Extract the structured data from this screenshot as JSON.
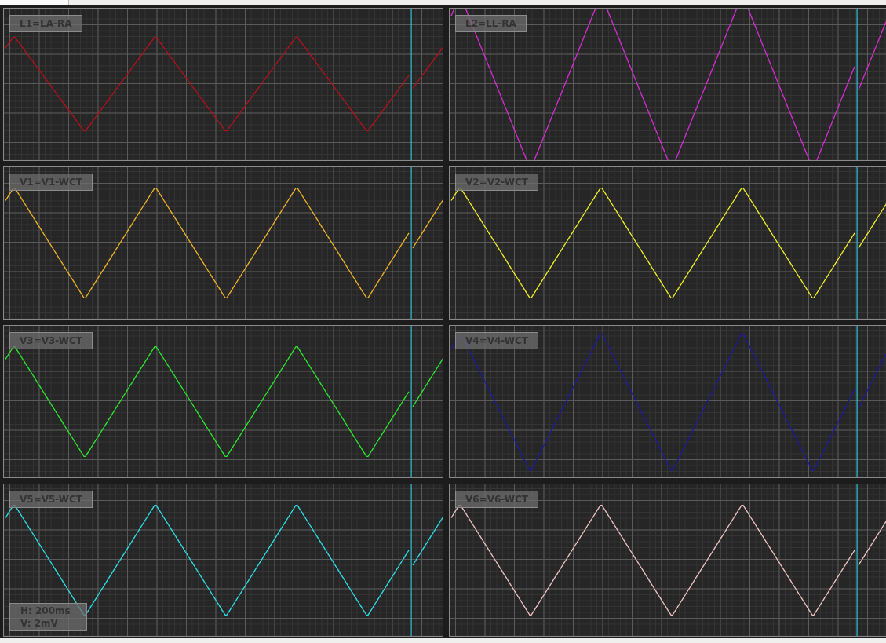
{
  "leads": [
    {
      "label": "L1=LA-RA",
      "color": "#b3121c"
    },
    {
      "label": "L2=LL-RA",
      "color": "#d42ed4"
    },
    {
      "label": "V1=V1-WCT",
      "color": "#f0b428"
    },
    {
      "label": "V2=V2-WCT",
      "color": "#f0f028"
    },
    {
      "label": "V3=V3-WCT",
      "color": "#2ee82e"
    },
    {
      "label": "V4=V4-WCT",
      "color": "#1c1c9c"
    },
    {
      "label": "V5=V5-WCT",
      "color": "#2ee0e8"
    },
    {
      "label": "V6=V6-WCT",
      "color": "#f2c4c4"
    }
  ],
  "scale": {
    "horizontal": "H: 200ms",
    "vertical": "V: 2mV"
  }
}
